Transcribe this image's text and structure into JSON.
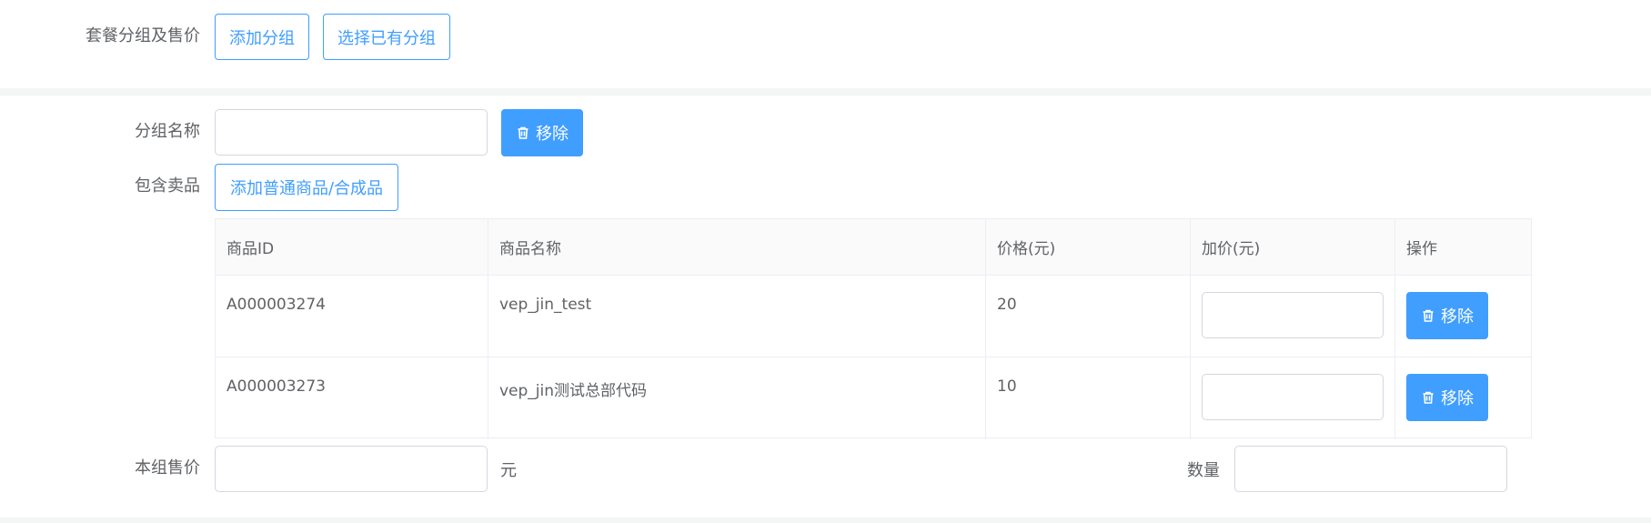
{
  "top": {
    "label": "套餐分组及售价",
    "add_group": "添加分组",
    "select_group": "选择已有分组"
  },
  "group": {
    "name_label": "分组名称",
    "name_value": "",
    "remove_label": "移除",
    "items_label": "包含卖品",
    "add_item": "添加普通商品/合成品"
  },
  "table": {
    "headers": [
      "商品ID",
      "商品名称",
      "价格(元)",
      "加价(元)",
      "操作"
    ],
    "rows": [
      {
        "id": "A000003274",
        "name": "vep_jin_test",
        "price": "20",
        "markup": "",
        "action": "移除"
      },
      {
        "id": "A000003273",
        "name": "vep_jin测试总部代码",
        "price": "10",
        "markup": "",
        "action": "移除"
      }
    ]
  },
  "footer": {
    "price_label": "本组售价",
    "price_value": "",
    "unit": "元",
    "qty_label": "数量",
    "qty_value": ""
  },
  "colors": {
    "primary": "#409eff",
    "band": "#f2f6f5"
  },
  "icons": {
    "remove": "trash-icon"
  }
}
